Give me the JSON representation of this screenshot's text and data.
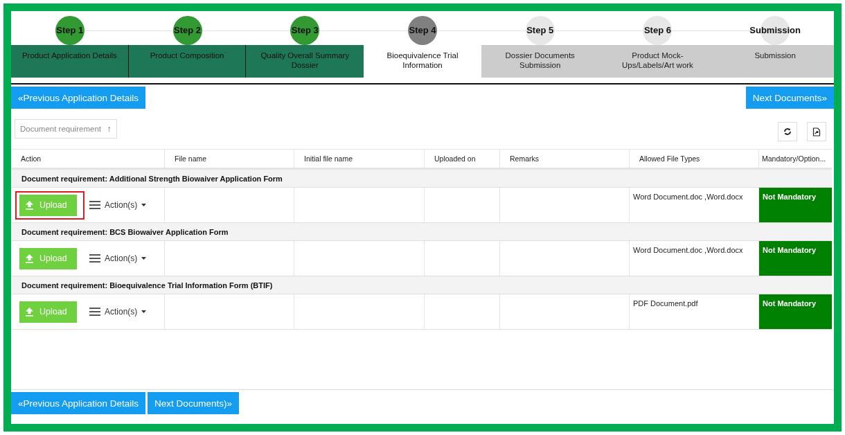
{
  "steps": [
    {
      "badge": "Step 1",
      "label": "Product Application Details",
      "completed": true,
      "selected": false
    },
    {
      "badge": "Step 2",
      "label": "Product Composition",
      "completed": true,
      "selected": false
    },
    {
      "badge": "Step 3",
      "label": "Quality Overall Summary Dossier",
      "completed": true,
      "selected": false
    },
    {
      "badge": "Step 4",
      "label": "Bioequivalence Trial Information",
      "completed": false,
      "selected": true
    },
    {
      "badge": "Step 5",
      "label": "Dossier Documents Submission",
      "completed": false,
      "selected": false
    },
    {
      "badge": "Step 6",
      "label": "Product Mock-Ups/Labels/Art work",
      "completed": false,
      "selected": false
    },
    {
      "badge": "Submission",
      "label": "Submission",
      "completed": false,
      "selected": false
    }
  ],
  "top_nav": {
    "previous": "«Previous Application Details",
    "next": "Next Documents»"
  },
  "sort_chip": {
    "label": "Document requirement",
    "arrow": "↑"
  },
  "table": {
    "columns": [
      "Action",
      "File name",
      "Initial file name",
      "Uploaded on",
      "Remarks",
      "Allowed File Types",
      "Mandatory/Option..."
    ],
    "groups": [
      {
        "title": "Document requirement: Additional Strength Biowaiver Application Form",
        "upload": "Upload",
        "actions": "Action(s)",
        "allowed_types": "Word Document.doc ,Word.docx",
        "mandatory": "Not Mandatory",
        "highlighted": true
      },
      {
        "title": "Document requirement: BCS Biowaiver Application Form",
        "upload": "Upload",
        "actions": "Action(s)",
        "allowed_types": "Word Document.doc ,Word.docx",
        "mandatory": "Not Mandatory",
        "highlighted": false
      },
      {
        "title": "Document requirement: Bioequivalence Trial Information Form (BTIF)",
        "upload": "Upload",
        "actions": "Action(s)",
        "allowed_types": "PDF Document.pdf",
        "mandatory": "Not Mandatory",
        "highlighted": false
      }
    ]
  },
  "bottom_nav": {
    "previous": "«Previous Application Details",
    "next": "Next Documents)»"
  }
}
